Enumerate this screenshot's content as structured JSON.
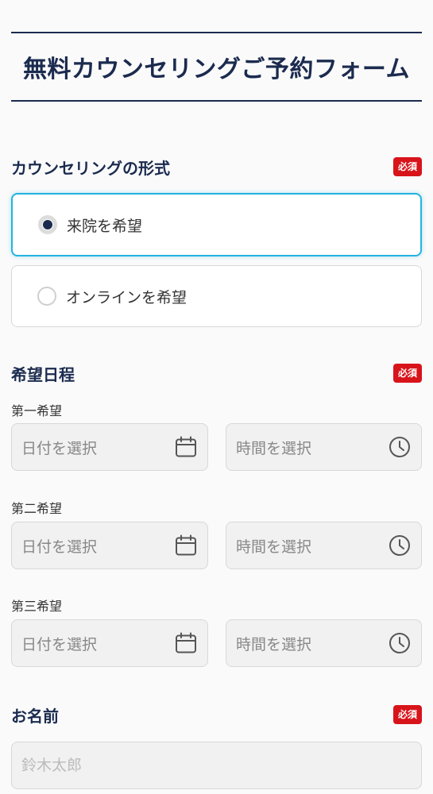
{
  "header": {
    "title": "無料カウンセリングご予約フォーム"
  },
  "counseling_type": {
    "title": "カウンセリングの形式",
    "required_badge": "必須",
    "options": [
      {
        "label": "来院を希望",
        "selected": true
      },
      {
        "label": "オンラインを希望",
        "selected": false
      }
    ]
  },
  "schedule": {
    "title": "希望日程",
    "required_badge": "必須",
    "preferences": [
      {
        "label": "第一希望",
        "date_placeholder": "日付を選択",
        "time_placeholder": "時間を選択"
      },
      {
        "label": "第二希望",
        "date_placeholder": "日付を選択",
        "time_placeholder": "時間を選択"
      },
      {
        "label": "第三希望",
        "date_placeholder": "日付を選択",
        "time_placeholder": "時間を選択"
      }
    ]
  },
  "name": {
    "title": "お名前",
    "required_badge": "必須",
    "placeholder": "鈴木太郎",
    "value": ""
  },
  "colors": {
    "navy": "#1b2b4f",
    "required_red": "#d8141b",
    "selected_border": "#24b3e0"
  },
  "icons": {
    "date": "calendar-icon",
    "time": "clock-icon"
  }
}
